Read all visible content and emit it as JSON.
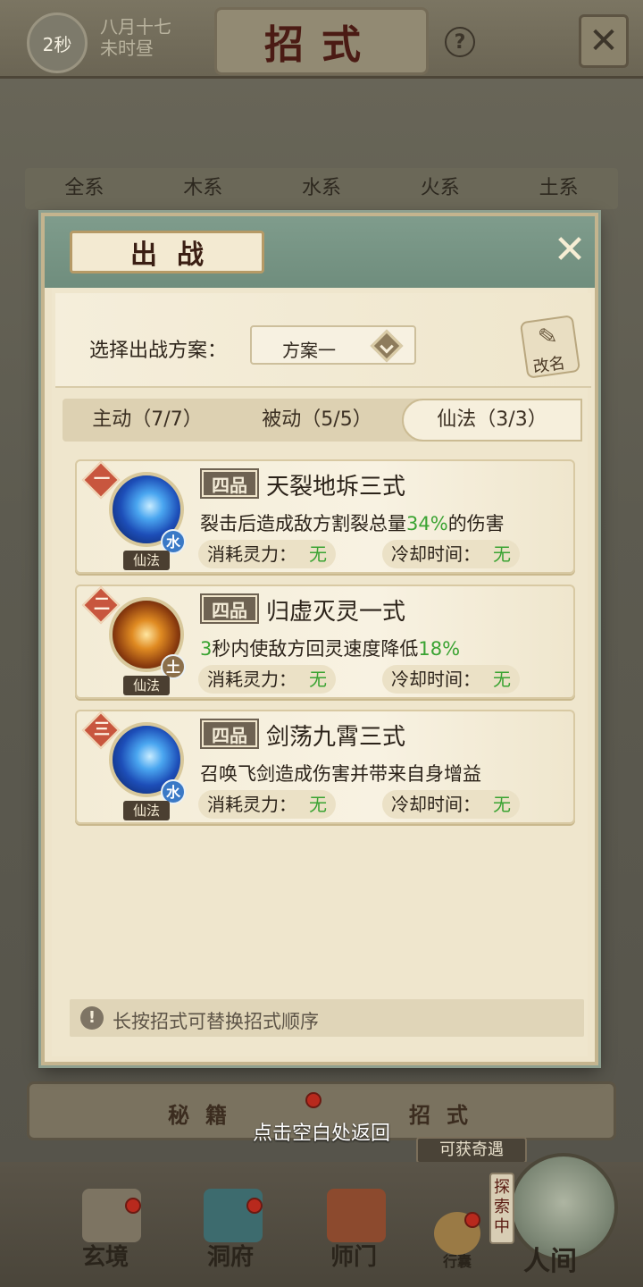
{
  "header": {
    "timer": "2秒",
    "date_line1": "八月十七",
    "date_line2": "未时昼",
    "title": "招式",
    "help": "?",
    "close": "✕"
  },
  "element_tabs": [
    "全系",
    "木系",
    "水系",
    "火系",
    "土系"
  ],
  "modal": {
    "title": "出战",
    "close": "✕",
    "plan_label": "选择出战方案：",
    "plan_value": "方案一",
    "rename_label": "改名",
    "tabs": [
      {
        "label": "主动（7/7）",
        "active": false
      },
      {
        "label": "被动（5/5）",
        "active": false
      },
      {
        "label": "仙法（3/3）",
        "active": true
      }
    ],
    "skills": [
      {
        "rank": "一",
        "grade": "四品",
        "name": "天裂地坼三式",
        "desc_pre": "裂击后造成敌方割裂总量",
        "desc_hl": "34%",
        "desc_post": "的伤害",
        "element": "水",
        "element_type": "water",
        "type_tag": "仙法",
        "cost_label": "消耗灵力：",
        "cost_value": "无",
        "cd_label": "冷却时间：",
        "cd_value": "无"
      },
      {
        "rank": "二",
        "grade": "四品",
        "name": "归虚灭灵一式",
        "desc_hl_pre": "3",
        "desc_mid": "秒内使敌方回灵速度降低",
        "desc_hl_post": "18%",
        "element": "土",
        "element_type": "earth",
        "type_tag": "仙法",
        "cost_label": "消耗灵力：",
        "cost_value": "无",
        "cd_label": "冷却时间：",
        "cd_value": "无"
      },
      {
        "rank": "三",
        "grade": "四品",
        "name": "剑荡九霄三式",
        "desc": "召唤飞剑造成伤害并带来自身增益",
        "element": "水",
        "element_type": "water",
        "type_tag": "仙法",
        "cost_label": "消耗灵力：",
        "cost_value": "无",
        "cd_label": "冷却时间：",
        "cd_value": "无"
      }
    ],
    "hint": "长按招式可替换招式顺序",
    "hint_icon": "!"
  },
  "bottom_tabs": [
    "秘籍",
    "招式"
  ],
  "tap_return": "点击空白处返回",
  "qiyu": "可获奇遇",
  "tansuo": "探索中",
  "nav": {
    "xuanjing": "玄境",
    "dongfu": "洞府",
    "shimen": "师门",
    "xingnang": "行囊",
    "renjian": "人间"
  },
  "colors": {
    "accent_green": "#3aa332",
    "modal_header": "#7f9c8c",
    "rank_badge": "#c8563e"
  }
}
